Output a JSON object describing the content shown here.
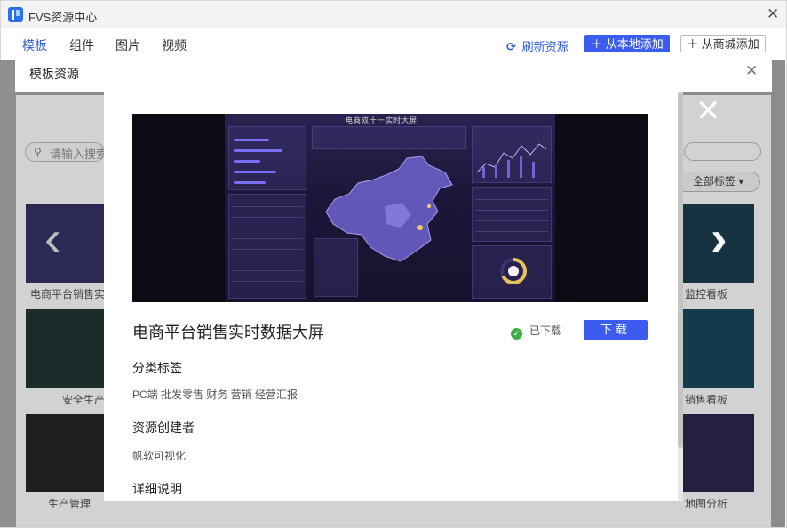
{
  "app": {
    "title": "FVS资源中心"
  },
  "nav": {
    "tabs": [
      {
        "label": "模板",
        "active": true
      },
      {
        "label": "组件",
        "active": false
      },
      {
        "label": "图片",
        "active": false
      },
      {
        "label": "视频",
        "active": false
      }
    ],
    "refresh_label": "刷新资源",
    "add_local_label": "＋ 从本地添加",
    "add_store_label": "＋ 从商城添加"
  },
  "background": {
    "search_placeholder": "请输入搜索",
    "tag_filter_label": "全部标签",
    "left_captions": [
      "电商平台销售实",
      "安全生产",
      "生产管理"
    ],
    "right_captions": [
      "监控看板",
      "销售看板",
      "地图分析"
    ]
  },
  "dialog": {
    "title": "模板资源",
    "item": {
      "title": "电商平台销售实时数据大屏",
      "status": "已下载",
      "download_label": "下载",
      "preview_title": "电商双十一实时大屏",
      "category_label": "分类标签",
      "tags": "PC端 批发零售 财务 营销 经营汇报",
      "creator_label": "资源创建者",
      "creator": "帆软可视化",
      "description_label": "详细说明"
    }
  },
  "colors": {
    "accent": "#3c5cf0",
    "link": "#2f5bd8",
    "success": "#3cb043",
    "overlay": "#8c8c8c"
  },
  "icons": {
    "refresh": "refresh-icon",
    "close": "close-icon",
    "check": "check-circle-icon",
    "prev": "chevron-left-icon",
    "next": "chevron-right-icon"
  }
}
